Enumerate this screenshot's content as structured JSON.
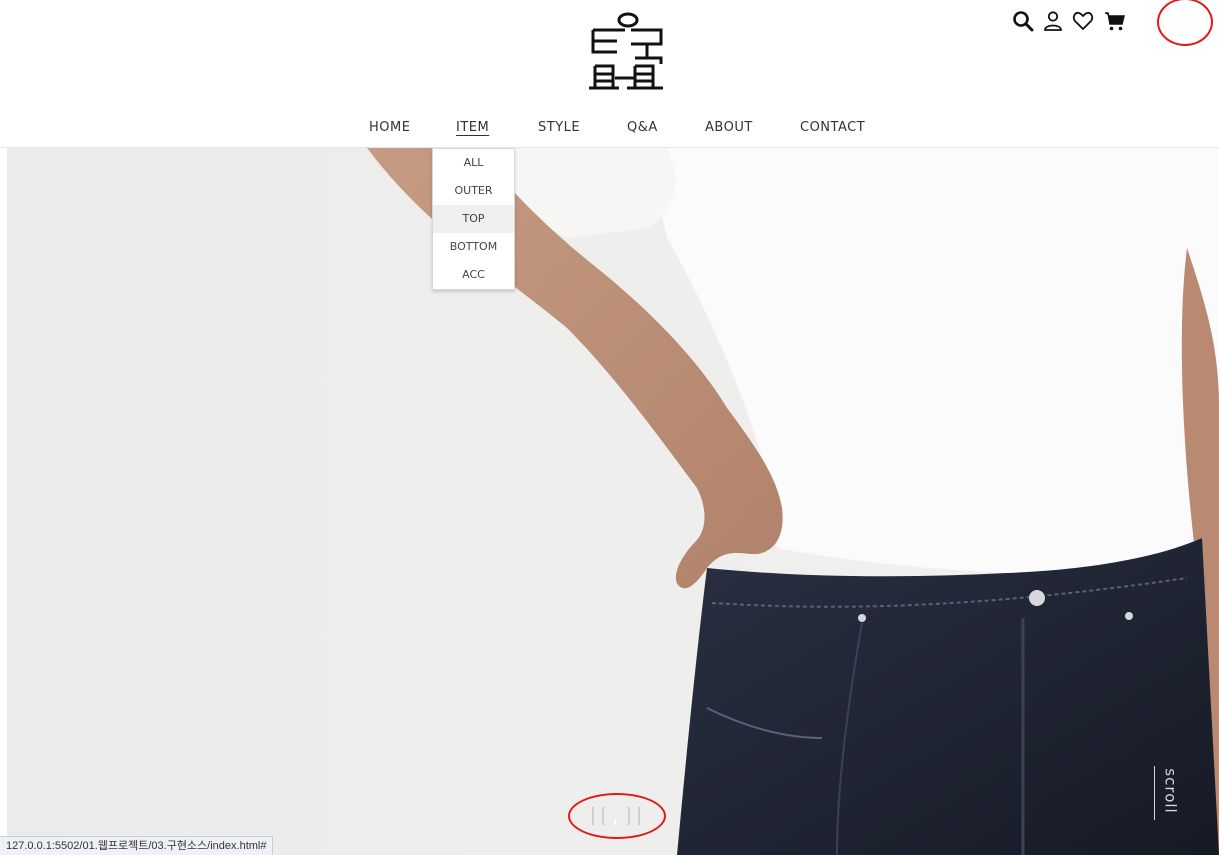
{
  "header": {
    "logo_alt": "logo",
    "icons": [
      "search-icon",
      "user-icon",
      "heart-icon",
      "cart-icon"
    ]
  },
  "nav": {
    "items": [
      {
        "label": "HOME"
      },
      {
        "label": "ITEM"
      },
      {
        "label": "STYLE"
      },
      {
        "label": "Q&A"
      },
      {
        "label": "ABOUT"
      },
      {
        "label": "CONTACT"
      }
    ],
    "active": "ITEM"
  },
  "dropdown": {
    "items": [
      "ALL",
      "OUTER",
      "TOP",
      "BOTTOM",
      "ACC"
    ],
    "hovered": "TOP"
  },
  "hero": {
    "scroll_label": "scroll",
    "slide_count": 5,
    "active_slide": 3
  },
  "status_bar": {
    "url": "127.0.0.1:5502/01.웹프로젝트/03.구현소스/index.html#"
  },
  "colors": {
    "annotation": "#e01a1a",
    "hero_bg": "#eeeeec",
    "denim": "#1f2433",
    "shirt": "#fbfbfb"
  }
}
